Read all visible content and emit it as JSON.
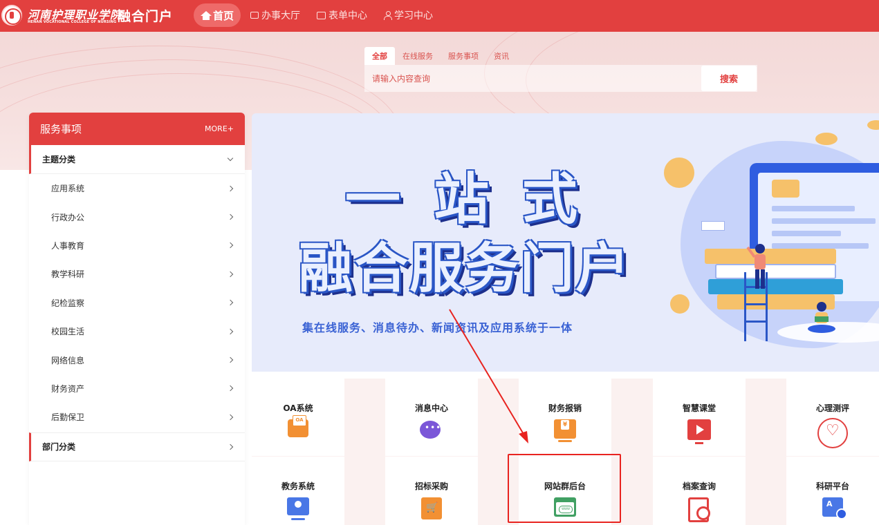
{
  "header": {
    "school_name_cn": "河南护理职业学院",
    "school_name_en": "HENAN VOCATIONAL COLLEGE OF NURSING",
    "portal_title": "融合门户",
    "nav": [
      {
        "label": "首页",
        "icon": "home-icon",
        "active": true
      },
      {
        "label": "办事大厅",
        "icon": "hall-icon",
        "active": false
      },
      {
        "label": "表单中心",
        "icon": "form-icon",
        "active": false
      },
      {
        "label": "学习中心",
        "icon": "user-icon",
        "active": false
      }
    ]
  },
  "search": {
    "tabs": [
      "全部",
      "在线服务",
      "服务事项",
      "资讯"
    ],
    "active_tab": "全部",
    "placeholder": "请输入内容查询",
    "button_label": "搜索"
  },
  "sidebar": {
    "title": "服务事项",
    "more": "MORE+",
    "categories": [
      {
        "label": "主题分类",
        "expanded": true,
        "items": [
          "应用系统",
          "行政办公",
          "人事教育",
          "教学科研",
          "纪检监察",
          "校园生活",
          "网络信息",
          "财务资产",
          "后勤保卫"
        ]
      },
      {
        "label": "部门分类",
        "expanded": false,
        "items": []
      }
    ]
  },
  "banner": {
    "line1": "一站式",
    "line2": "融合服务门户",
    "subtitle": "集在线服务、消息待办、新闻资讯及应用系统于一体"
  },
  "apps": [
    {
      "label": "OA系统",
      "icon": "oa-icon"
    },
    {
      "label": "消息中心",
      "icon": "message-icon"
    },
    {
      "label": "财务报销",
      "icon": "finance-icon"
    },
    {
      "label": "智慧课堂",
      "icon": "video-icon"
    },
    {
      "label": "心理测评",
      "icon": "heart-icon"
    },
    {
      "label": "教务系统",
      "icon": "academic-icon"
    },
    {
      "label": "招标采购",
      "icon": "cart-icon"
    },
    {
      "label": "网站群后台",
      "icon": "website-icon"
    },
    {
      "label": "档案查询",
      "icon": "archive-search-icon"
    },
    {
      "label": "科研平台",
      "icon": "research-icon"
    }
  ],
  "colors": {
    "brand_red": "#e2403f",
    "annotation_red": "#e8231f",
    "banner_blue": "#2a56c6"
  }
}
